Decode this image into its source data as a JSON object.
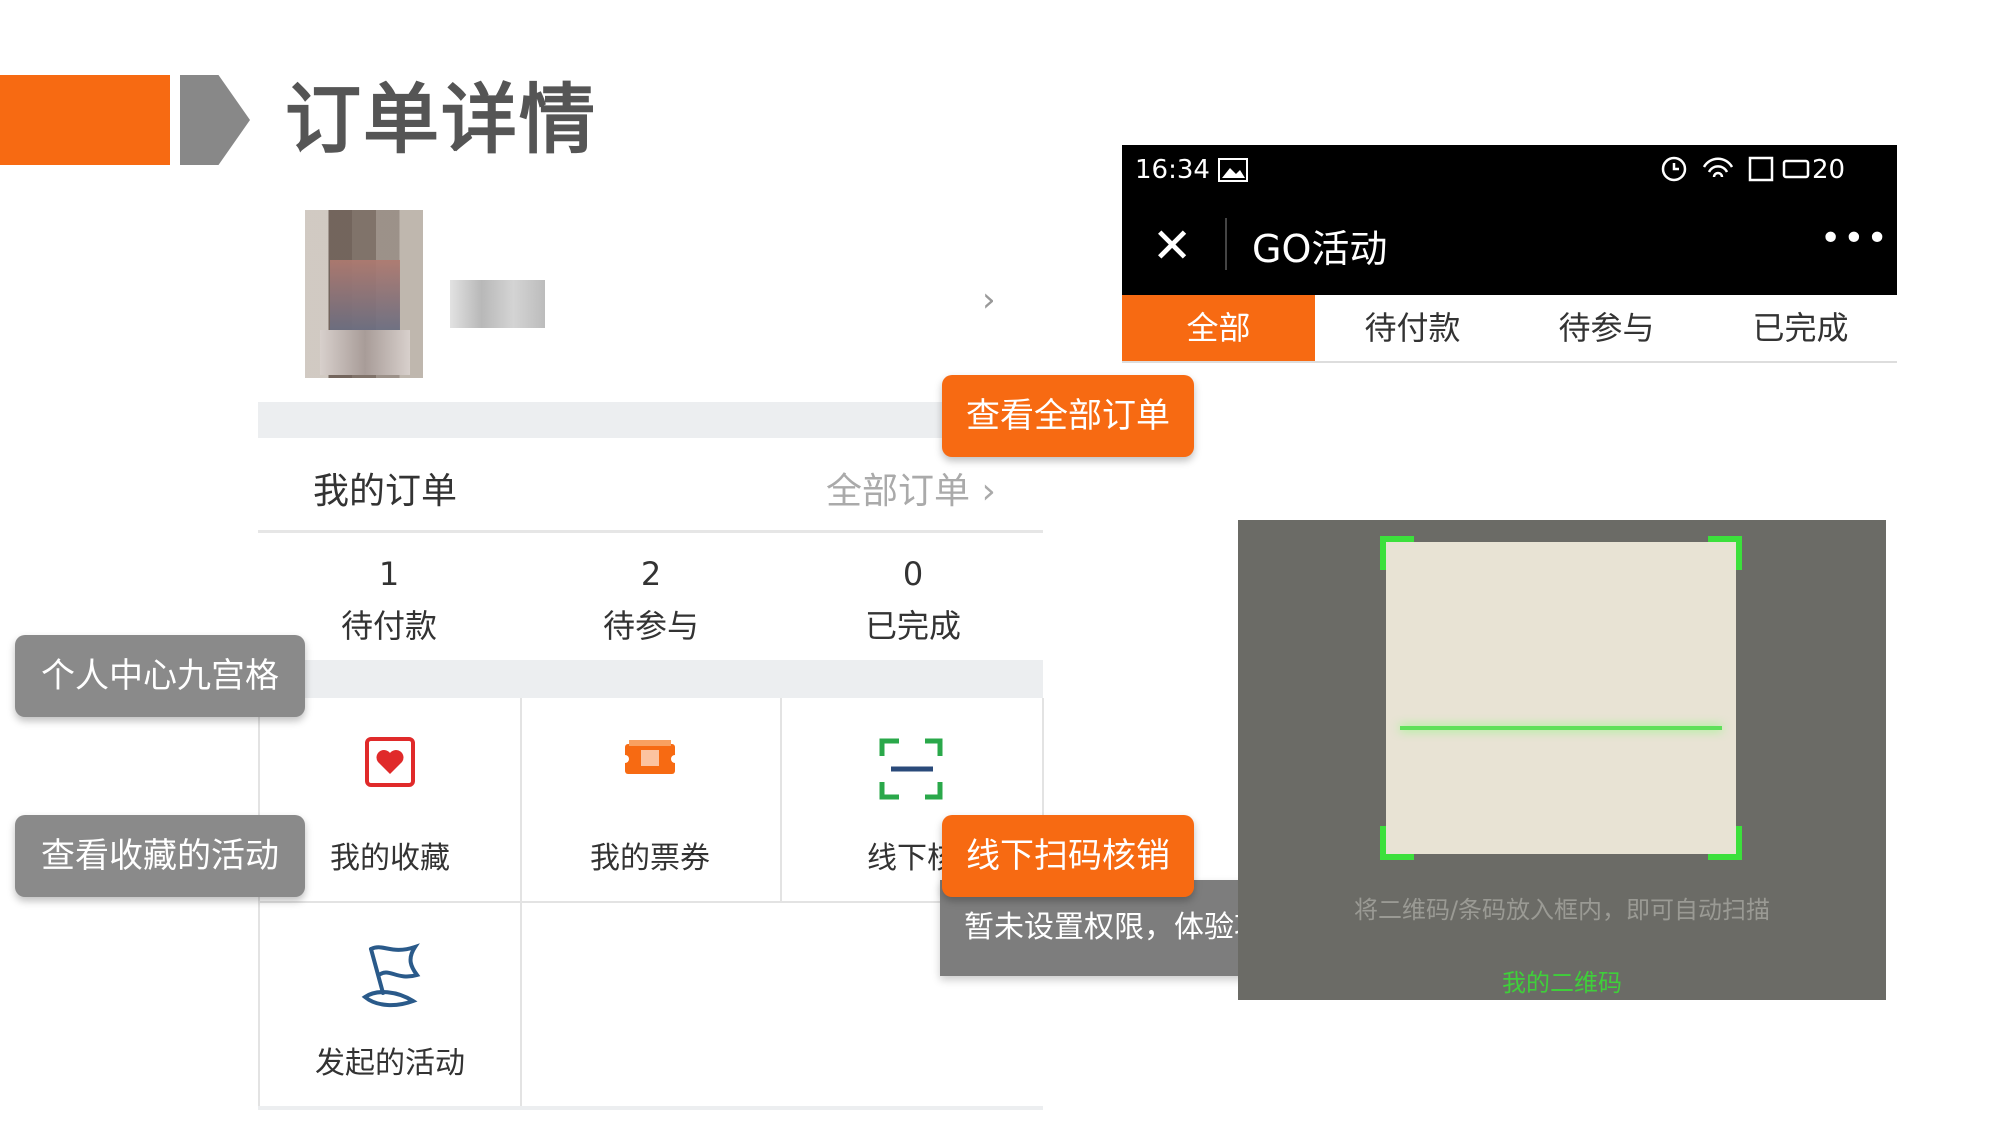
{
  "header": {
    "title": "订单详情"
  },
  "profile": {
    "chevron": "›"
  },
  "orders": {
    "title": "我的订单",
    "all_link": "全部订单 ›",
    "counts": [
      {
        "value": "1",
        "label": "待付款"
      },
      {
        "value": "2",
        "label": "待参与"
      },
      {
        "value": "0",
        "label": "已完成"
      }
    ]
  },
  "grid": {
    "items": [
      {
        "label": "我的收藏",
        "icon": "heart-card-icon"
      },
      {
        "label": "我的票券",
        "icon": "ticket-icon"
      },
      {
        "label": "线下核",
        "icon": "scan-icon"
      },
      {
        "label": "发起的活动",
        "icon": "flag-icon"
      }
    ]
  },
  "callouts": {
    "view_all_orders": "查看全部订单",
    "personal_grid": "个人中心九宫格",
    "view_favorites": "查看收藏的活动",
    "offline_scan": "线下扫码核销",
    "no_permission": "暂未设置权限，体验功能"
  },
  "phone": {
    "status": {
      "time": "16:34",
      "battery": "20"
    },
    "title": "GO活动",
    "close": "✕",
    "more": "•••",
    "tabs": [
      "全部",
      "待付款",
      "待参与",
      "已完成"
    ],
    "active_tab": "全部",
    "scanner": {
      "hint": "将二维码/条码放入框内，即可自动扫描",
      "my_qr": "我的二维码"
    }
  },
  "colors": {
    "accent": "#f76a12",
    "gray": "#8a8a8a",
    "scan_green": "#3ce03c"
  }
}
